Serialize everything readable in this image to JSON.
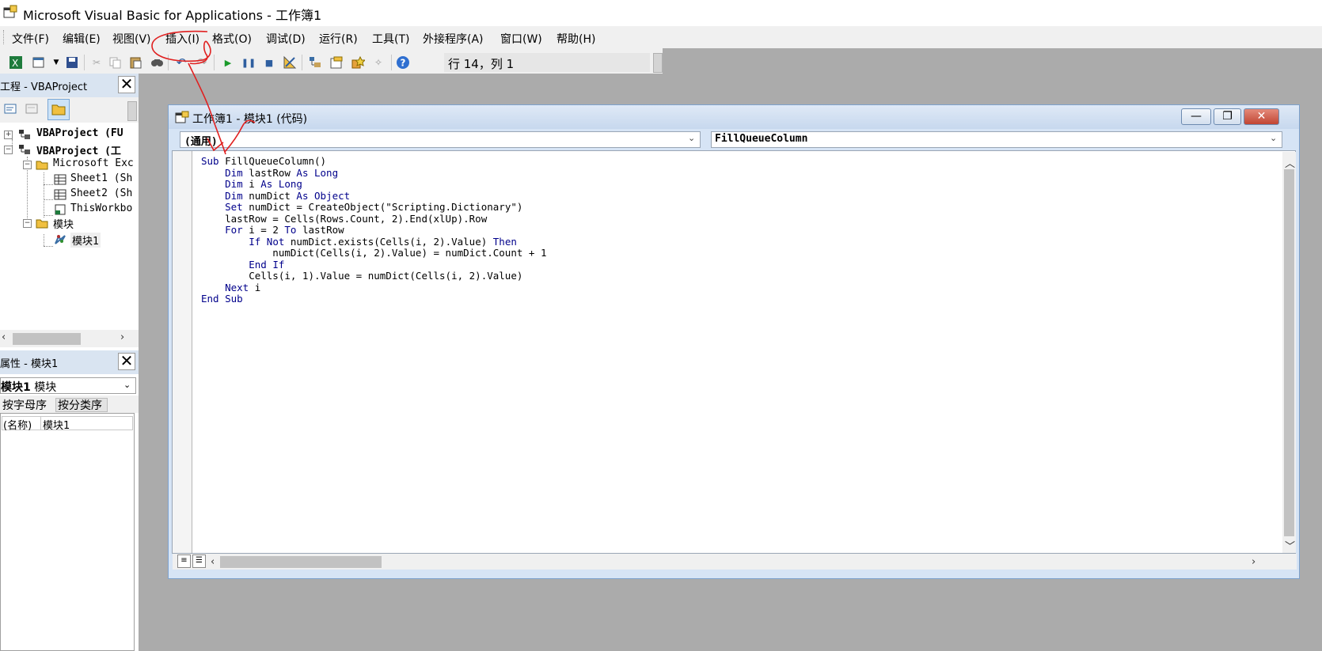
{
  "window": {
    "title": "Microsoft Visual Basic for Applications - 工作簿1"
  },
  "menu": [
    "文件(F)",
    "编辑(E)",
    "视图(V)",
    "插入(I)",
    "格式(O)",
    "调试(D)",
    "运行(R)",
    "工具(T)",
    "外接程序(A)",
    "窗口(W)",
    "帮助(H)"
  ],
  "toolbar": {
    "status": "行 14，列 1"
  },
  "project": {
    "title": "工程 - VBAProject",
    "nodes": [
      {
        "label": "VBAProject (FU"
      },
      {
        "label": "VBAProject (工"
      },
      {
        "label": "Microsoft Exc"
      },
      {
        "label": "Sheet1 (Sh"
      },
      {
        "label": "Sheet2 (Sh"
      },
      {
        "label": "ThisWorkbo"
      },
      {
        "label": "模块"
      },
      {
        "label": "模块1"
      }
    ]
  },
  "properties": {
    "title": "属性 - 模块1",
    "object_name": "模块1",
    "object_type": "模块",
    "tabs": [
      "按字母序",
      "按分类序"
    ],
    "row_name": "(名称)",
    "row_value": "模块1"
  },
  "code_window": {
    "title": "工作簿1 - 模块1 (代码)",
    "object_combo": "(通用)",
    "procedure_combo": "FillQueueColumn"
  },
  "code": [
    "Sub FillQueueColumn()",
    "    Dim lastRow As Long",
    "    Dim i As Long",
    "    Dim numDict As Object",
    "    Set numDict = CreateObject(\"Scripting.Dictionary\")",
    "    lastRow = Cells(Rows.Count, 2).End(xlUp).Row",
    "    For i = 2 To lastRow",
    "        If Not numDict.exists(Cells(i, 2).Value) Then",
    "            numDict(Cells(i, 2).Value) = numDict.Count + 1",
    "        End If",
    "        Cells(i, 1).Value = numDict(Cells(i, 2).Value)",
    "    Next i",
    "End Sub"
  ],
  "colors": {
    "keyword": "#00008b",
    "annotation": "#e02020",
    "panel_header": "#d9e4f1"
  }
}
